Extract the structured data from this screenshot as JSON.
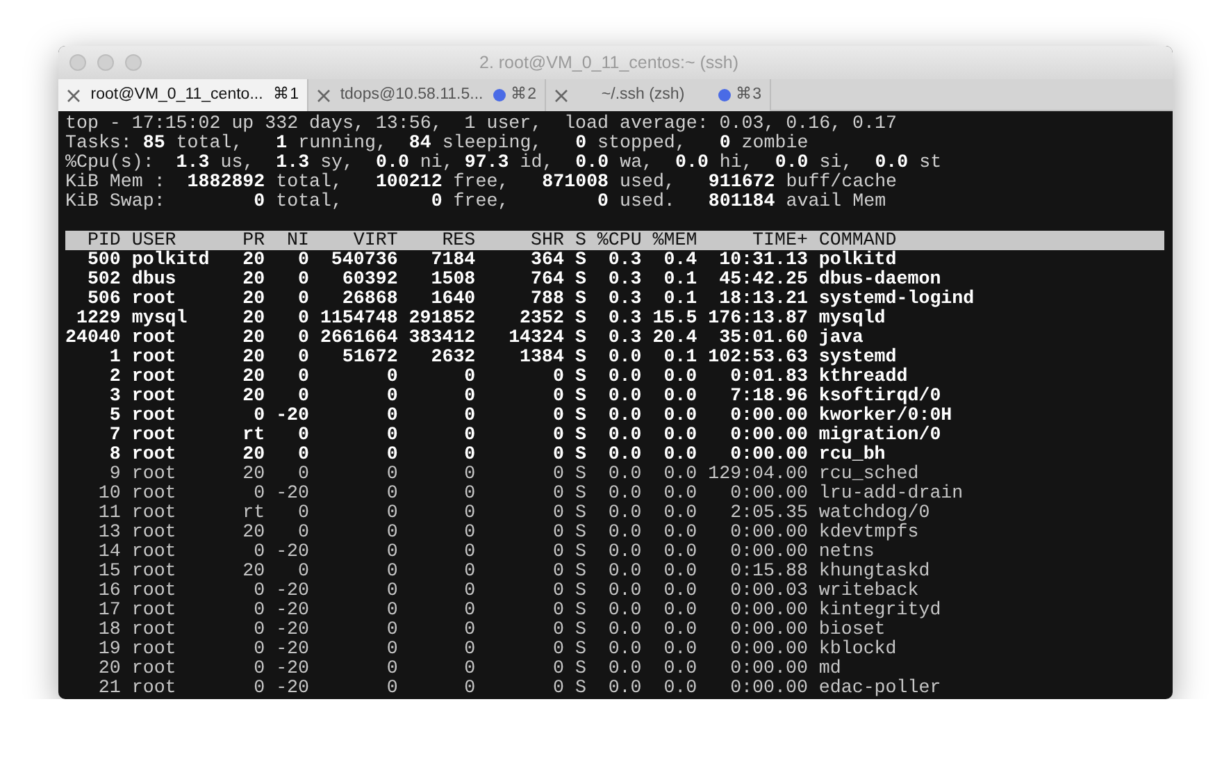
{
  "window": {
    "title": "2. root@VM_0_11_centos:~ (ssh)"
  },
  "tabs": [
    {
      "label": "root@VM_0_11_cento...",
      "shortcut": "⌘1",
      "selected": true,
      "activity": false
    },
    {
      "label": "tdops@10.58.11.5...",
      "shortcut": "⌘2",
      "selected": false,
      "activity": true
    },
    {
      "label": "~/.ssh (zsh)",
      "shortcut": "⌘3",
      "selected": false,
      "activity": true
    }
  ],
  "summary": [
    "top - 17:15:02 up 332 days, 13:56,  1 user,  load average: 0.03, 0.16, 0.17",
    "Tasks: **85** total,   **1** running,  **84** sleeping,   **0** stopped,   **0** zombie",
    "%Cpu(s):  **1.3** us,  **1.3** sy,  **0.0** ni, **97.3** id,  **0.0** wa,  **0.0** hi,  **0.0** si,  **0.0** st",
    "KiB Mem :  **1882892** total,   **100212** free,   **871008** used,   **911672** buff/cache",
    "KiB Swap:        **0** total,        **0** free,        **0** used.   **801184** avail Mem"
  ],
  "table": {
    "columns": [
      "PID",
      "USER",
      "PR",
      "NI",
      "VIRT",
      "RES",
      "SHR",
      "S",
      "%CPU",
      "%MEM",
      "TIME+",
      "COMMAND"
    ],
    "rows": [
      {
        "bold": true,
        "cells": [
          "500",
          "polkitd",
          "20",
          "0",
          "540736",
          "7184",
          "364",
          "S",
          "0.3",
          "0.4",
          "10:31.13",
          "polkitd"
        ]
      },
      {
        "bold": true,
        "cells": [
          "502",
          "dbus",
          "20",
          "0",
          "60392",
          "1508",
          "764",
          "S",
          "0.3",
          "0.1",
          "45:42.25",
          "dbus-daemon"
        ]
      },
      {
        "bold": true,
        "cells": [
          "506",
          "root",
          "20",
          "0",
          "26868",
          "1640",
          "788",
          "S",
          "0.3",
          "0.1",
          "18:13.21",
          "systemd-logind"
        ]
      },
      {
        "bold": true,
        "cells": [
          "1229",
          "mysql",
          "20",
          "0",
          "1154748",
          "291852",
          "2352",
          "S",
          "0.3",
          "15.5",
          "176:13.87",
          "mysqld"
        ]
      },
      {
        "bold": true,
        "cells": [
          "24040",
          "root",
          "20",
          "0",
          "2661664",
          "383412",
          "14324",
          "S",
          "0.3",
          "20.4",
          "35:01.60",
          "java"
        ]
      },
      {
        "bold": true,
        "cells": [
          "1",
          "root",
          "20",
          "0",
          "51672",
          "2632",
          "1384",
          "S",
          "0.0",
          "0.1",
          "102:53.63",
          "systemd"
        ]
      },
      {
        "bold": true,
        "cells": [
          "2",
          "root",
          "20",
          "0",
          "0",
          "0",
          "0",
          "S",
          "0.0",
          "0.0",
          "0:01.83",
          "kthreadd"
        ]
      },
      {
        "bold": true,
        "cells": [
          "3",
          "root",
          "20",
          "0",
          "0",
          "0",
          "0",
          "S",
          "0.0",
          "0.0",
          "7:18.96",
          "ksoftirqd/0"
        ]
      },
      {
        "bold": true,
        "cells": [
          "5",
          "root",
          "0",
          "-20",
          "0",
          "0",
          "0",
          "S",
          "0.0",
          "0.0",
          "0:00.00",
          "kworker/0:0H"
        ]
      },
      {
        "bold": true,
        "cells": [
          "7",
          "root",
          "rt",
          "0",
          "0",
          "0",
          "0",
          "S",
          "0.0",
          "0.0",
          "0:00.00",
          "migration/0"
        ]
      },
      {
        "bold": true,
        "cells": [
          "8",
          "root",
          "20",
          "0",
          "0",
          "0",
          "0",
          "S",
          "0.0",
          "0.0",
          "0:00.00",
          "rcu_bh"
        ]
      },
      {
        "bold": false,
        "cells": [
          "9",
          "root",
          "20",
          "0",
          "0",
          "0",
          "0",
          "S",
          "0.0",
          "0.0",
          "129:04.00",
          "rcu_sched"
        ]
      },
      {
        "bold": false,
        "cells": [
          "10",
          "root",
          "0",
          "-20",
          "0",
          "0",
          "0",
          "S",
          "0.0",
          "0.0",
          "0:00.00",
          "lru-add-drain"
        ]
      },
      {
        "bold": false,
        "cells": [
          "11",
          "root",
          "rt",
          "0",
          "0",
          "0",
          "0",
          "S",
          "0.0",
          "0.0",
          "2:05.35",
          "watchdog/0"
        ]
      },
      {
        "bold": false,
        "cells": [
          "13",
          "root",
          "20",
          "0",
          "0",
          "0",
          "0",
          "S",
          "0.0",
          "0.0",
          "0:00.00",
          "kdevtmpfs"
        ]
      },
      {
        "bold": false,
        "cells": [
          "14",
          "root",
          "0",
          "-20",
          "0",
          "0",
          "0",
          "S",
          "0.0",
          "0.0",
          "0:00.00",
          "netns"
        ]
      },
      {
        "bold": false,
        "cells": [
          "15",
          "root",
          "20",
          "0",
          "0",
          "0",
          "0",
          "S",
          "0.0",
          "0.0",
          "0:15.88",
          "khungtaskd"
        ]
      },
      {
        "bold": false,
        "cells": [
          "16",
          "root",
          "0",
          "-20",
          "0",
          "0",
          "0",
          "S",
          "0.0",
          "0.0",
          "0:00.03",
          "writeback"
        ]
      },
      {
        "bold": false,
        "cells": [
          "17",
          "root",
          "0",
          "-20",
          "0",
          "0",
          "0",
          "S",
          "0.0",
          "0.0",
          "0:00.00",
          "kintegrityd"
        ]
      },
      {
        "bold": false,
        "cells": [
          "18",
          "root",
          "0",
          "-20",
          "0",
          "0",
          "0",
          "S",
          "0.0",
          "0.0",
          "0:00.00",
          "bioset"
        ]
      },
      {
        "bold": false,
        "cells": [
          "19",
          "root",
          "0",
          "-20",
          "0",
          "0",
          "0",
          "S",
          "0.0",
          "0.0",
          "0:00.00",
          "kblockd"
        ]
      },
      {
        "bold": false,
        "cells": [
          "20",
          "root",
          "0",
          "-20",
          "0",
          "0",
          "0",
          "S",
          "0.0",
          "0.0",
          "0:00.00",
          "md"
        ]
      },
      {
        "bold": false,
        "cells": [
          "21",
          "root",
          "0",
          "-20",
          "0",
          "0",
          "0",
          "S",
          "0.0",
          "0.0",
          "0:00.00",
          "edac-poller"
        ]
      }
    ]
  }
}
